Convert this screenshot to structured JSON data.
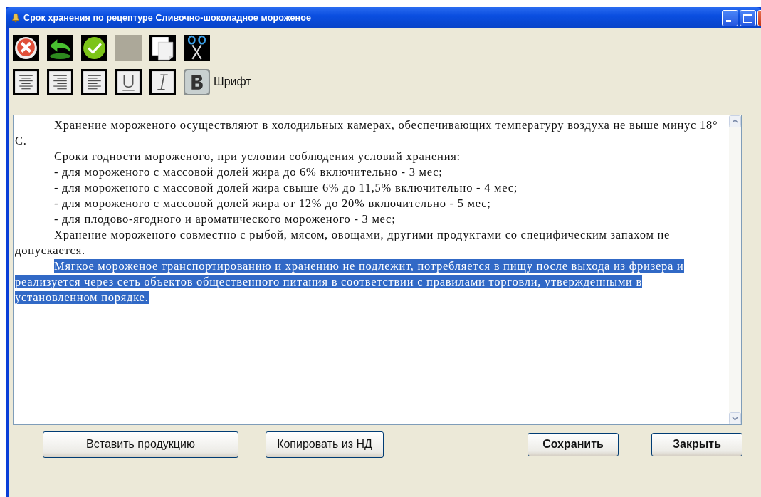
{
  "window": {
    "title": "Срок хранения по рецептуре Сливочно-шоколадное мороженое"
  },
  "toolbar_rows": [
    [
      {
        "kind": "delete"
      },
      {
        "kind": "undo"
      },
      {
        "kind": "accept"
      },
      {
        "kind": "empty"
      },
      {
        "kind": "copy"
      },
      {
        "kind": "cut"
      }
    ],
    [
      {
        "kind": "align-center"
      },
      {
        "kind": "align-right"
      },
      {
        "kind": "align-left"
      },
      {
        "kind": "underline"
      },
      {
        "kind": "italic"
      },
      {
        "kind": "bold"
      }
    ]
  ],
  "font_label": "Шрифт",
  "editor": {
    "lines": [
      {
        "kind": "indent",
        "selected": false,
        "text": "Хранение мороженого осуществляют в холодильных камерах, обеспечивающих температуру воздуха не выше минус 18°"
      },
      {
        "kind": "plain",
        "selected": false,
        "text": "С."
      },
      {
        "kind": "indent",
        "selected": false,
        "text": "Сроки годности мороженого, при условии соблюдения условий хранения:"
      },
      {
        "kind": "indent",
        "selected": false,
        "text": "- для мороженого с массовой долей жира до 6% включительно - 3 мес;"
      },
      {
        "kind": "indent",
        "selected": false,
        "text": "- для мороженого с массовой долей жира свыше 6% до 11,5% включительно - 4 мес;"
      },
      {
        "kind": "indent",
        "selected": false,
        "text": "- для мороженого с массовой долей жира от 12% до 20% включительно - 5 мес;"
      },
      {
        "kind": "indent",
        "selected": false,
        "text": "- для плодово-ягодного и ароматического мороженого - 3 мес;"
      },
      {
        "kind": "indent",
        "selected": false,
        "text": "Хранение мороженого совместно с рыбой, мясом, овощами, другими продуктами со специфическим запахом не"
      },
      {
        "kind": "plain",
        "selected": false,
        "text": "допускается."
      },
      {
        "kind": "indent",
        "selected": true,
        "text": "Мягкое мороженое транспортированию и хранению не подлежит, потребляется в пищу после выхода из фризера и"
      },
      {
        "kind": "plain",
        "selected": true,
        "text": "реализуется через сеть объектов общественного питания в соответствии с правилами торговли, утвержденными в"
      },
      {
        "kind": "plain",
        "selected": true,
        "text": "установленном порядке."
      }
    ]
  },
  "buttons": [
    {
      "label": "Вставить продукцию",
      "kind": "wide"
    },
    {
      "label": "Копировать из НД",
      "kind": "plain"
    },
    {
      "label": "Сохранить",
      "kind": "bold"
    },
    {
      "label": "Закрыть",
      "kind": "bold"
    }
  ]
}
